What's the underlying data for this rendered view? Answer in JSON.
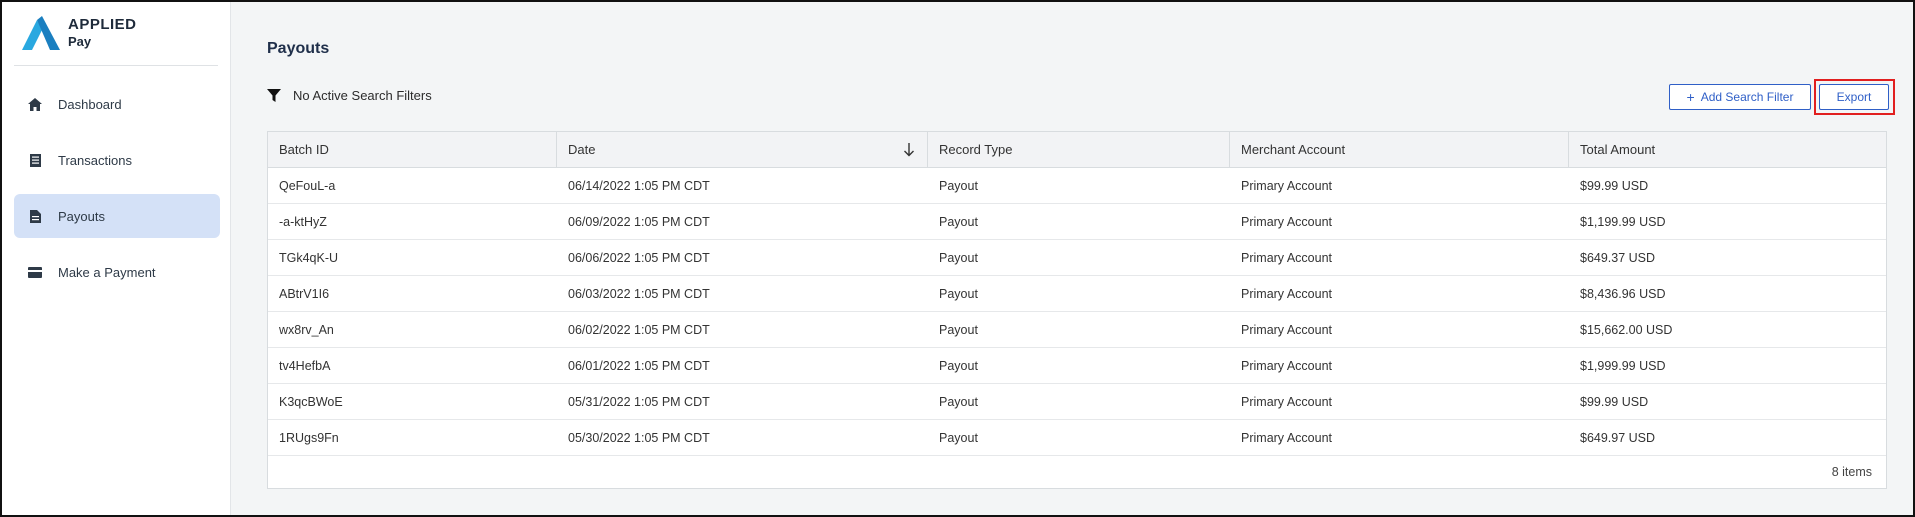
{
  "brand": {
    "name": "APPLIED",
    "sub": "Pay",
    "accent": "#29a8e0",
    "accent_dark": "#1a7fc0"
  },
  "sidebar": {
    "items": [
      {
        "label": "Dashboard",
        "icon": "home-icon",
        "active": false
      },
      {
        "label": "Transactions",
        "icon": "receipt-icon",
        "active": false
      },
      {
        "label": "Payouts",
        "icon": "document-icon",
        "active": true
      },
      {
        "label": "Make a Payment",
        "icon": "credit-card-icon",
        "active": false
      }
    ]
  },
  "page": {
    "title": "Payouts"
  },
  "filters": {
    "status_text": "No Active Search Filters"
  },
  "toolbar": {
    "add_filter_label": "Add Search Filter",
    "export_label": "Export"
  },
  "table": {
    "columns": [
      "Batch ID",
      "Date",
      "Record Type",
      "Merchant Account",
      "Total Amount"
    ],
    "sorted_column": "Date",
    "sort_direction": "descending",
    "rows": [
      [
        "QeFouL-a",
        "06/14/2022 1:05 PM CDT",
        "Payout",
        "Primary Account",
        "$99.99 USD"
      ],
      [
        "-a-ktHyZ",
        "06/09/2022 1:05 PM CDT",
        "Payout",
        "Primary Account",
        "$1,199.99 USD"
      ],
      [
        "TGk4qK-U",
        "06/06/2022 1:05 PM CDT",
        "Payout",
        "Primary Account",
        "$649.37 USD"
      ],
      [
        "ABtrV1I6",
        "06/03/2022 1:05 PM CDT",
        "Payout",
        "Primary Account",
        "$8,436.96 USD"
      ],
      [
        "wx8rv_An",
        "06/02/2022 1:05 PM CDT",
        "Payout",
        "Primary Account",
        "$15,662.00 USD"
      ],
      [
        "tv4HefbA",
        "06/01/2022 1:05 PM CDT",
        "Payout",
        "Primary Account",
        "$1,999.99 USD"
      ],
      [
        "K3qcBWoE",
        "05/31/2022 1:05 PM CDT",
        "Payout",
        "Primary Account",
        "$99.99 USD"
      ],
      [
        "1RUgs9Fn",
        "05/30/2022 1:05 PM CDT",
        "Payout",
        "Primary Account",
        "$649.97 USD"
      ]
    ],
    "footer": "8 items"
  }
}
